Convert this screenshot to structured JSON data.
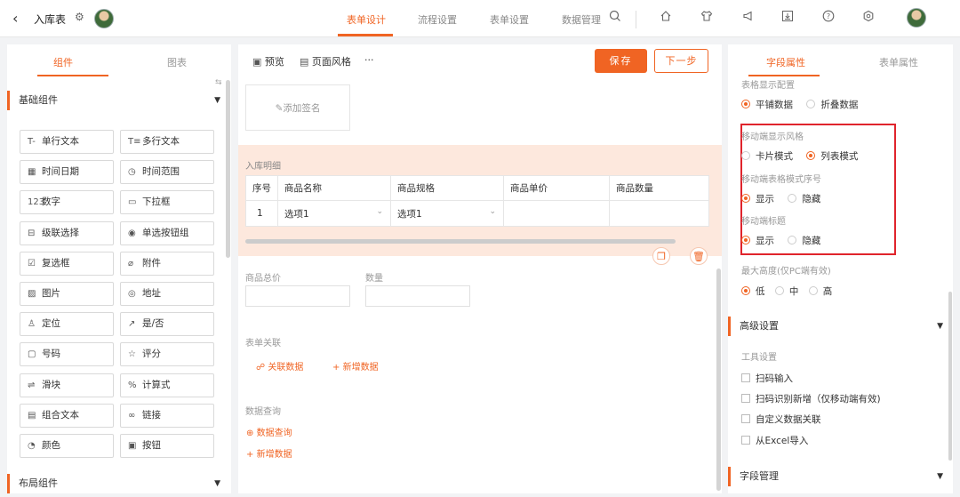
{
  "header": {
    "back_icon": "chevron-left-icon",
    "title": "入库表",
    "gear_icon": "gear-icon",
    "nav_tabs": [
      {
        "label": "表单设计",
        "active": true
      },
      {
        "label": "流程设置",
        "active": false
      },
      {
        "label": "表单设置",
        "active": false
      },
      {
        "label": "数据管理",
        "active": false
      }
    ],
    "right_icons": [
      "search-icon",
      "home-icon",
      "shirt-icon",
      "megaphone-icon",
      "download-icon",
      "help-icon",
      "settings-icon"
    ],
    "accent_color": "#f06423"
  },
  "left_panel": {
    "tabs": [
      {
        "label": "组件",
        "active": true
      },
      {
        "label": "图表",
        "active": false
      }
    ],
    "basic_section": "基础组件",
    "layout_section": "布局组件",
    "components": [
      {
        "icon": "T-",
        "label": "单行文本"
      },
      {
        "icon": "T≡",
        "label": "多行文本"
      },
      {
        "icon": "▦",
        "label": "时间日期"
      },
      {
        "icon": "◷",
        "label": "时间范围"
      },
      {
        "icon": "123",
        "label": "数字"
      },
      {
        "icon": "▭",
        "label": "下拉框"
      },
      {
        "icon": "⊟",
        "label": "级联选择"
      },
      {
        "icon": "◉",
        "label": "单选按钮组"
      },
      {
        "icon": "☑",
        "label": "复选框"
      },
      {
        "icon": "⌀",
        "label": "附件"
      },
      {
        "icon": "▨",
        "label": "图片"
      },
      {
        "icon": "◎",
        "label": "地址"
      },
      {
        "icon": "♙",
        "label": "定位"
      },
      {
        "icon": "↗",
        "label": "是/否"
      },
      {
        "icon": "▢",
        "label": "号码"
      },
      {
        "icon": "☆",
        "label": "评分"
      },
      {
        "icon": "⇌",
        "label": "滑块"
      },
      {
        "icon": "%",
        "label": "计算式"
      },
      {
        "icon": "▤",
        "label": "组合文本"
      },
      {
        "icon": "∞",
        "label": "链接"
      },
      {
        "icon": "◔",
        "label": "颜色"
      },
      {
        "icon": "▣",
        "label": "按钮"
      }
    ]
  },
  "center_panel": {
    "toolbar": {
      "preview": "预览",
      "style": "页面风格",
      "more": "···",
      "save": "保存",
      "next": "下一步"
    },
    "signature": "添加签名",
    "detail": {
      "title": "入库明细",
      "columns": [
        "序号",
        "商品名称",
        "商品规格",
        "商品单价",
        "商品数量"
      ],
      "rows": [
        [
          "1",
          "选项1",
          "选项1",
          "",
          ""
        ]
      ]
    },
    "fields": {
      "total_price": "商品总价",
      "quantity": "数量"
    },
    "relation": {
      "title": "表单关联",
      "link_data": "关联数据",
      "add_data": "新增数据"
    },
    "query": {
      "title": "数据查询",
      "query_link": "数据查询",
      "add_data": "新增数据"
    }
  },
  "right_panel": {
    "tabs": [
      {
        "label": "字段属性",
        "active": true
      },
      {
        "label": "表单属性",
        "active": false
      }
    ],
    "table_display": {
      "label": "表格显示配置",
      "options": [
        "平铺数据",
        "折叠数据"
      ],
      "selected": 0
    },
    "mobile_style": {
      "label": "移动端显示风格",
      "options": [
        "卡片模式",
        "列表模式"
      ],
      "selected": 1
    },
    "mobile_serial": {
      "label": "移动端表格模式序号",
      "options": [
        "显示",
        "隐藏"
      ],
      "selected": 0
    },
    "mobile_title": {
      "label": "移动端标题",
      "options": [
        "显示",
        "隐藏"
      ],
      "selected": 0
    },
    "max_height": {
      "label": "最大高度(仅PC端有效)",
      "options": [
        "低",
        "中",
        "高"
      ],
      "selected": 0
    },
    "advanced": "高级设置",
    "tools": {
      "label": "工具设置",
      "items": [
        "扫码输入",
        "扫码识别新增（仅移动端有效)",
        "自定义数据关联",
        "从Excel导入"
      ]
    },
    "field_manage": "字段管理"
  }
}
